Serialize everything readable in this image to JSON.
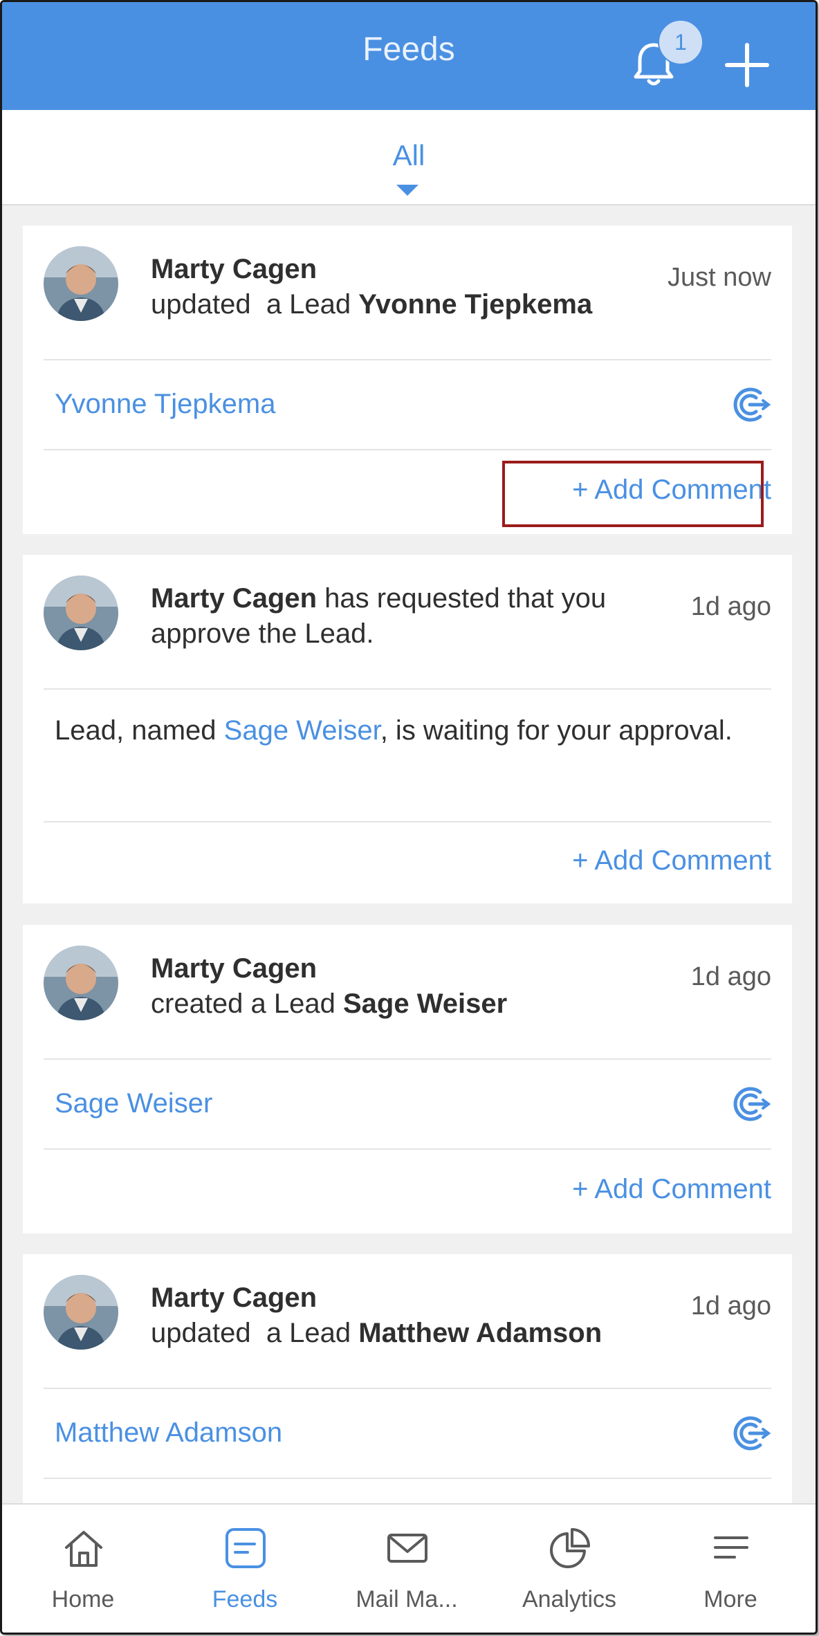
{
  "header": {
    "title": "Feeds",
    "notification_count": "1"
  },
  "tabs": {
    "active": "All"
  },
  "feed": [
    {
      "actor": "Marty Cagen",
      "action": "updated  a Lead",
      "target": "Yvonne Tjepkema",
      "time": "Just now",
      "link": "Yvonne Tjepkema",
      "add_comment": "+ Add Comment"
    },
    {
      "actor": "Marty Cagen",
      "action": " has requested that you approve the Lead.",
      "time": "1d ago",
      "body_prefix": "Lead, named ",
      "body_link": "Sage Weiser",
      "body_suffix": ", is waiting for your approval.",
      "add_comment": "+ Add Comment"
    },
    {
      "actor": "Marty Cagen",
      "action": "created a Lead",
      "target": "Sage Weiser",
      "time": "1d ago",
      "link": "Sage Weiser",
      "add_comment": "+ Add Comment"
    },
    {
      "actor": "Marty Cagen",
      "action": "updated  a Lead",
      "target": "Matthew Adamson",
      "time": "1d ago",
      "link": "Matthew Adamson"
    }
  ],
  "bottom_nav": [
    {
      "label": "Home",
      "icon": "home-icon"
    },
    {
      "label": "Feeds",
      "icon": "feeds-icon",
      "active": true
    },
    {
      "label": "Mail Ma...",
      "icon": "mail-icon"
    },
    {
      "label": "Analytics",
      "icon": "pie-chart-icon"
    },
    {
      "label": "More",
      "icon": "menu-icon"
    }
  ],
  "colors": {
    "accent": "#4a90e2",
    "highlight_border": "#9b1b1b"
  }
}
